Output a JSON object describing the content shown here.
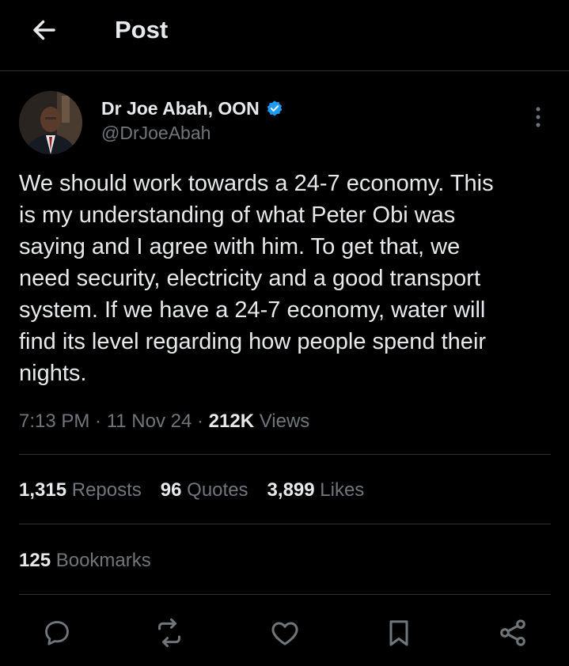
{
  "header": {
    "title": "Post"
  },
  "author": {
    "name": "Dr Joe Abah, OON",
    "handle": "@DrJoeAbah",
    "verified": true
  },
  "tweet": {
    "text": "We should work towards a 24-7 economy. This\nis my understanding of what Peter Obi was\nsaying and I agree with him. To get that, we\nneed security, electricity and a good transport\nsystem. If we have a 24-7 economy, water will\nfind its level regarding how people spend their\nnights."
  },
  "meta": {
    "time": "7:13 PM",
    "sep1": " · ",
    "date": "11 Nov 24",
    "sep2": " · ",
    "views_count": "212K",
    "views_label": " Views"
  },
  "stats": {
    "reposts": {
      "count": "1,315",
      "label": "Reposts"
    },
    "quotes": {
      "count": "96",
      "label": "Quotes"
    },
    "likes": {
      "count": "3,899",
      "label": "Likes"
    },
    "bookmarks": {
      "count": "125",
      "label": "Bookmarks"
    }
  },
  "icons": {
    "back": "arrow-left-icon",
    "more": "more-vertical-icon",
    "reply": "reply-icon",
    "repost": "repost-icon",
    "like": "heart-icon",
    "bookmark": "bookmark-icon",
    "share": "share-icon"
  },
  "colors": {
    "background": "#000000",
    "text": "#e7e9ea",
    "muted": "#71767b",
    "divider": "#2f3336",
    "verified": "#1d9bf0"
  }
}
